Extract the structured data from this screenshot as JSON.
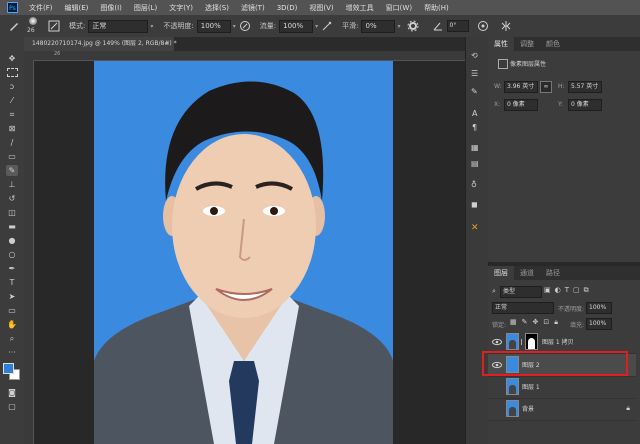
{
  "menu": {
    "items": [
      "文件(F)",
      "编辑(E)",
      "图像(I)",
      "图层(L)",
      "文字(Y)",
      "选择(S)",
      "滤镜(T)",
      "3D(D)",
      "视图(V)",
      "增效工具",
      "窗口(W)",
      "帮助(H)"
    ]
  },
  "options": {
    "brush_size": "26",
    "mode_label": "模式:",
    "mode_value": "正常",
    "opacity_label": "不透明度:",
    "opacity_value": "100%",
    "flow_label": "流量:",
    "flow_value": "100%",
    "smooth_label": "平滑:",
    "smooth_value": "0%"
  },
  "document": {
    "tab_title": "1480220710174.jpg @ 149% (图层 2, RGB/8#) *",
    "close": "×",
    "ruler_mark": "26"
  },
  "properties": {
    "tabs": [
      "属性",
      "调整",
      "颜色"
    ],
    "section_title": "像素图层属性",
    "w_label": "W:",
    "w_value": "3.96 英寸",
    "link_icon": "∞",
    "h_label": "H:",
    "h_value": "5.57 英寸",
    "x_label": "X:",
    "x_value": "0 像素",
    "y_label": "Y:",
    "y_value": "0 像素"
  },
  "layers": {
    "tabs": [
      "图层",
      "通道",
      "路径"
    ],
    "filter_label": "类型",
    "blend_mode": "正常",
    "opacity_label": "不透明度:",
    "opacity_value": "100%",
    "lock_label": "锁定:",
    "fill_label": "填充:",
    "fill_value": "100%",
    "items": [
      {
        "name": "图层 1 拷贝",
        "visible": true
      },
      {
        "name": "图层 2",
        "visible": true,
        "selected": true
      },
      {
        "name": "图层 1",
        "visible": false
      },
      {
        "name": "背景",
        "visible": false,
        "locked": true
      }
    ]
  },
  "colors": {
    "canvas_bg": "#3a8ae0",
    "highlight": "#e02020",
    "foreground": "#2f7fd6",
    "background": "#ffffff"
  }
}
